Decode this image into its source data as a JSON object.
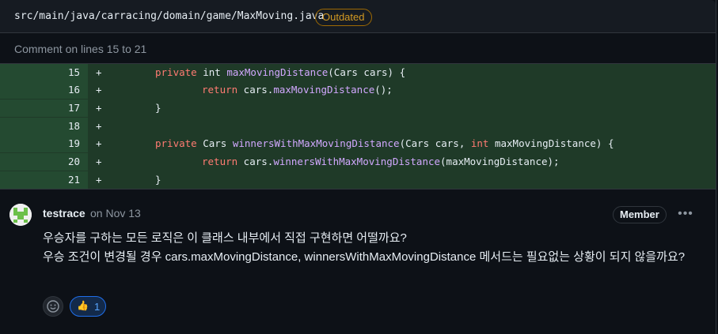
{
  "file": {
    "path": "src/main/java/carracing/domain/game/MaxMoving.java",
    "badge": "Outdated"
  },
  "comment_lines": "Comment on lines 15 to 21",
  "code": {
    "lines": [
      {
        "num": "15",
        "marker": "+"
      },
      {
        "num": "16",
        "marker": "+"
      },
      {
        "num": "17",
        "marker": "+"
      },
      {
        "num": "18",
        "marker": "+"
      },
      {
        "num": "19",
        "marker": "+"
      },
      {
        "num": "20",
        "marker": "+"
      },
      {
        "num": "21",
        "marker": "+"
      }
    ],
    "tokens": {
      "l15_kw1": "private",
      "l15_t1": " int ",
      "l15_fn": "maxMovingDistance",
      "l15_t2": "(Cars cars) {",
      "l16_kw": "return",
      "l16_t1": " cars.",
      "l16_fn": "maxMovingDistance",
      "l16_t2": "();",
      "l17": "}",
      "l19_kw1": "private",
      "l19_t1": " Cars ",
      "l19_fn": "winnersWithMaxMovingDistance",
      "l19_t2": "(Cars cars, ",
      "l19_kw2": "int",
      "l19_t3": " maxMovingDistance) {",
      "l20_kw": "return",
      "l20_t1": " cars.",
      "l20_fn": "winnersWithMaxMovingDistance",
      "l20_t2": "(maxMovingDistance);",
      "l21": "}"
    }
  },
  "comment": {
    "author": "testrace",
    "meta": "on Nov 13",
    "role_badge": "Member",
    "more_icon": "kebab-horizontal-icon",
    "line1": "우승자를 구하는 모든 로직은 이 클래스 내부에서 직접 구현하면 어떨까요?",
    "line2": "우승 조건이 변경될 경우 cars.maxMovingDistance, winnersWithMaxMovingDistance 메서드는 필요없는 상황이 되지 않을까요?",
    "reactions": {
      "add_icon": "smiley-icon",
      "thumbs_icon": "thumbs-up-icon",
      "thumbs_count": "1"
    }
  },
  "colors": {
    "background": "#0d1117",
    "added_line_bg": "#1f3a28",
    "keyword": "#ff7b72",
    "function": "#d2a8ff",
    "outdated": "#d29922",
    "reaction_active": "#58a6ff"
  }
}
